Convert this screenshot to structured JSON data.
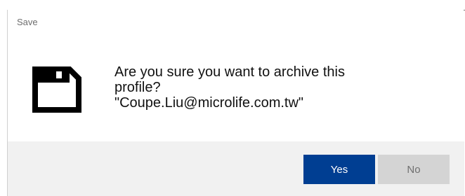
{
  "dialog": {
    "title": "Save",
    "icon": "floppy-disk-icon",
    "message_lines": [
      "Are you sure you want to archive this",
      "profile?",
      "\"Coupe.Liu@microlife.com.tw\""
    ]
  },
  "buttons": {
    "yes_label": "Yes",
    "no_label": "No"
  },
  "colors": {
    "primary_button": "#003e92",
    "secondary_button": "#d4d4d4",
    "footer_background": "#f1f1f1"
  }
}
